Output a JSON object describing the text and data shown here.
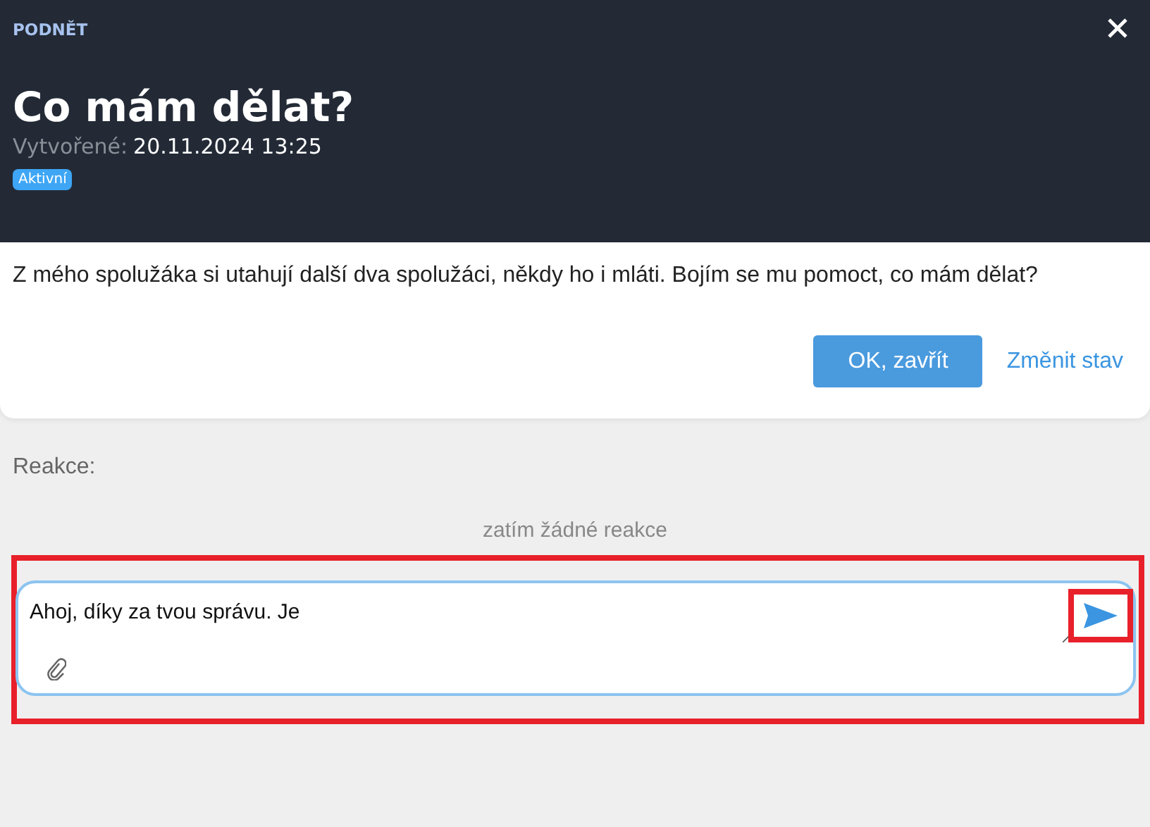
{
  "header": {
    "category": "PODNĚT",
    "title": "Co mám dělat?",
    "created_label": "Vytvořené:",
    "created_value": "20.11.2024 13:25",
    "status_badge": "Aktivní"
  },
  "message": {
    "text": "Z mého spolužáka si utahují další dva spolužáci, někdy ho i mláti. Bojím se mu pomoct, co mám dělat?",
    "buttons": [
      {
        "label": "OK, zavřít",
        "kind": "primary"
      },
      {
        "label": "Změnit stav",
        "kind": "link"
      }
    ]
  },
  "reactions": {
    "label": "Reakce:",
    "empty_text": "zatím žádné reakce"
  },
  "composer": {
    "value": "Ahoj, díky za tvou správu. Je",
    "highlighted": true,
    "send_highlighted": true
  }
}
